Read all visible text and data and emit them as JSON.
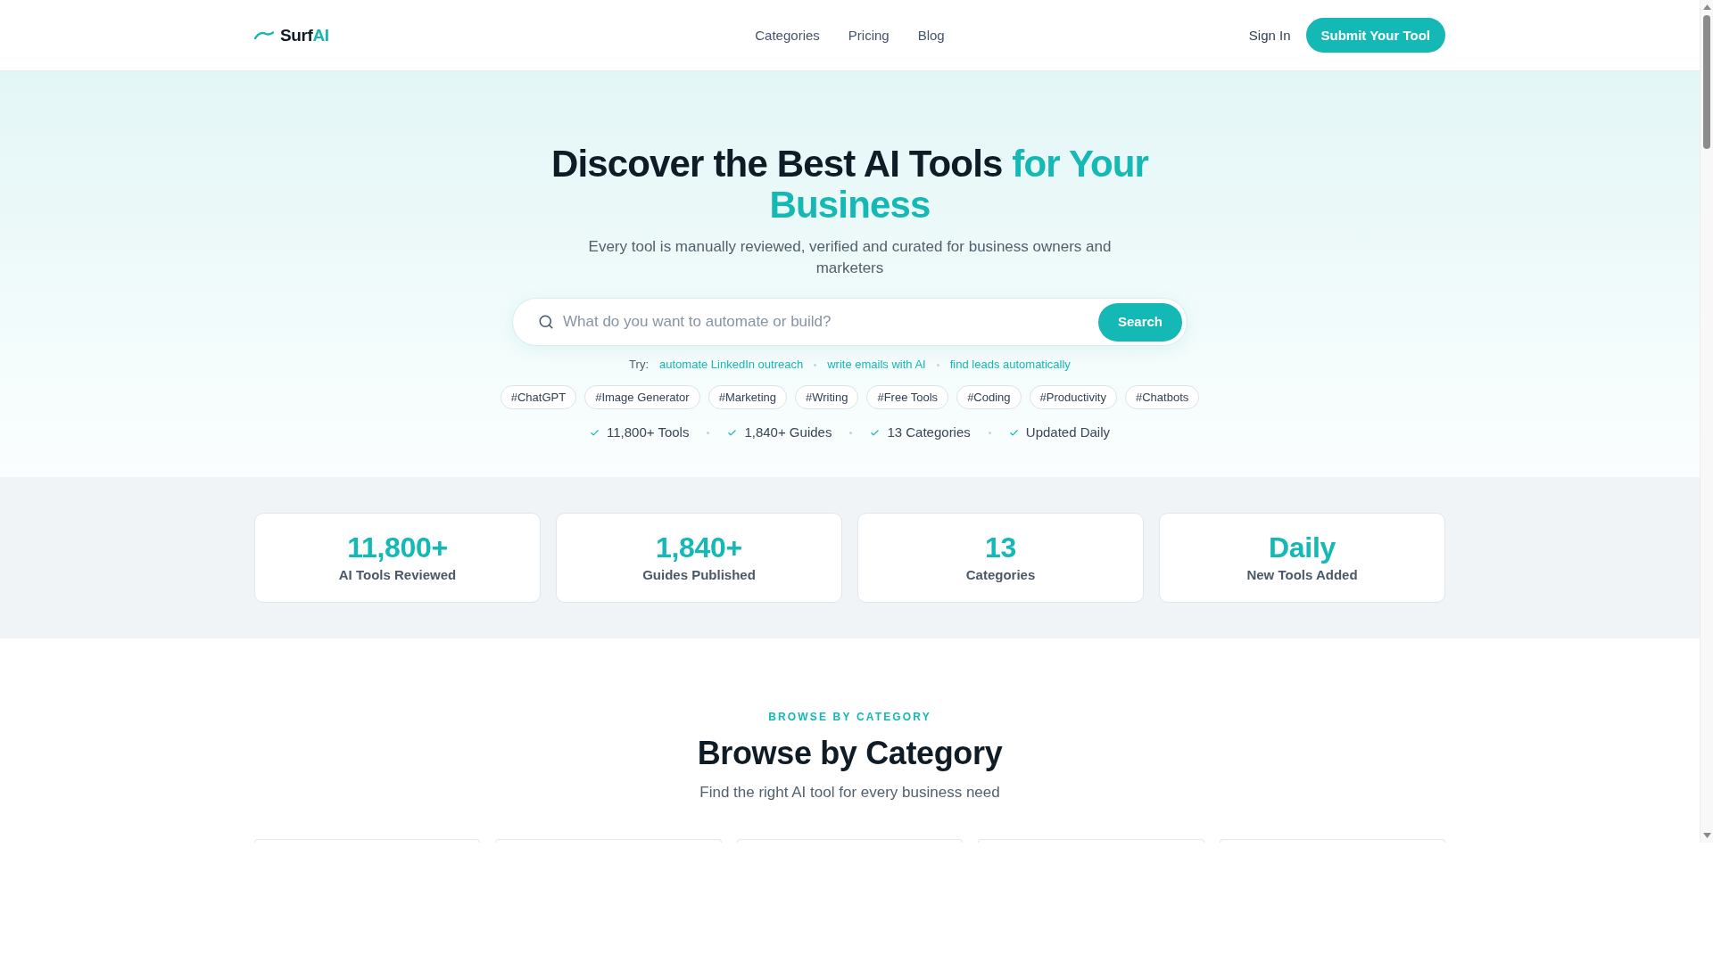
{
  "header": {
    "logo": {
      "word": "Surf",
      "accent": "AI"
    },
    "nav": [
      {
        "label": "Categories"
      },
      {
        "label": "Pricing"
      },
      {
        "label": "Blog"
      }
    ],
    "sign_in": "Sign In",
    "cta": "Submit Your Tool"
  },
  "hero": {
    "heading": "Discover the Best AI Tools",
    "heading_highlight": "for Your Business",
    "subtitle": "Every tool is manually reviewed, verified and curated for business owners and marketers",
    "search": {
      "placeholder": "What do you want to automate or build?",
      "button": "Search"
    },
    "try_label": "Try:",
    "suggestions": [
      "automate LinkedIn outreach",
      "write emails with AI",
      "find leads automatically"
    ],
    "tags": [
      "#ChatGPT",
      "#Image Generator",
      "#Marketing",
      "#Writing",
      "#Free Tools",
      "#Coding",
      "#Productivity",
      "#Chatbots"
    ],
    "highlights": [
      "11,800+ Tools",
      "1,840+ Guides",
      "13 Categories",
      "Updated Daily"
    ]
  },
  "stats": [
    {
      "value": "11,800+",
      "label": "AI Tools Reviewed"
    },
    {
      "value": "1,840+",
      "label": "Guides Published"
    },
    {
      "value": "13",
      "label": "Categories"
    },
    {
      "value": "Daily",
      "label": "New Tools Added"
    }
  ],
  "browse": {
    "eyebrow": "BROWSE BY CATEGORY",
    "title": "Browse by Category",
    "subtitle": "Find the right AI tool for every business need"
  }
}
